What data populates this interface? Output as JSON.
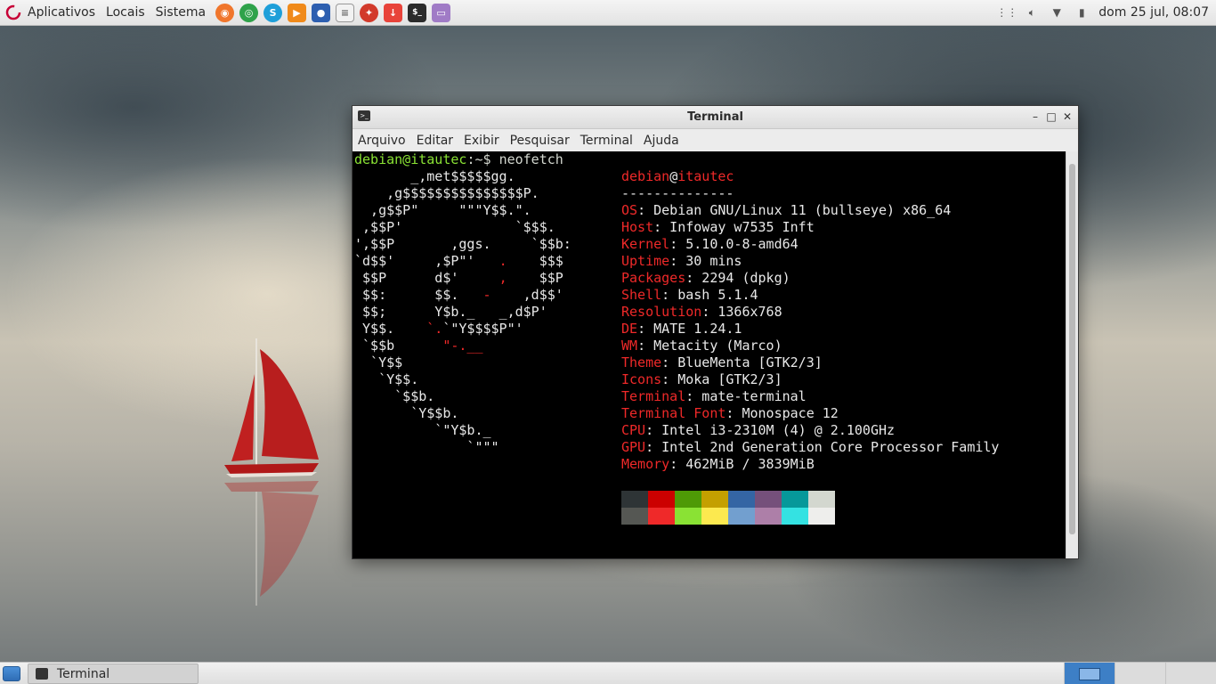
{
  "top_panel": {
    "menus": [
      "Aplicativos",
      "Locais",
      "Sistema"
    ],
    "launchers": [
      {
        "icon": "firefox-icon",
        "color": "#f0762c"
      },
      {
        "icon": "chrome-icon",
        "color": "#2fa24a"
      },
      {
        "icon": "skype-icon",
        "color": "#1e9fd9"
      },
      {
        "icon": "vlc-icon",
        "color": "#f08a1a"
      },
      {
        "icon": "obs-icon",
        "color": "#2d5fb0"
      },
      {
        "icon": "text-editor-icon",
        "color": "#f2f2f2"
      },
      {
        "icon": "transmission-icon",
        "color": "#d23a2b"
      },
      {
        "icon": "downloader-icon",
        "color": "#e8433a"
      },
      {
        "icon": "terminal-icon",
        "color": "#2b2b2b"
      },
      {
        "icon": "file-manager-icon",
        "color": "#a07bc6"
      }
    ],
    "clock": "dom 25 jul, 08:07"
  },
  "window": {
    "title": "Terminal",
    "menu": [
      "Arquivo",
      "Editar",
      "Exibir",
      "Pesquisar",
      "Terminal",
      "Ajuda"
    ]
  },
  "terminal": {
    "prompt_user": "debian@itautec",
    "prompt_path": ":~$ ",
    "command": "neofetch",
    "header": "debian@itautec",
    "separator": "--------------",
    "info": [
      {
        "label": "OS",
        "value": ": Debian GNU/Linux 11 (bullseye) x86_64"
      },
      {
        "label": "Host",
        "value": ": Infoway w7535 Inft"
      },
      {
        "label": "Kernel",
        "value": ": 5.10.0-8-amd64"
      },
      {
        "label": "Uptime",
        "value": ": 30 mins"
      },
      {
        "label": "Packages",
        "value": ": 2294 (dpkg)"
      },
      {
        "label": "Shell",
        "value": ": bash 5.1.4"
      },
      {
        "label": "Resolution",
        "value": ": 1366x768"
      },
      {
        "label": "DE",
        "value": ": MATE 1.24.1"
      },
      {
        "label": "WM",
        "value": ": Metacity (Marco)"
      },
      {
        "label": "Theme",
        "value": ": BlueMenta [GTK2/3]"
      },
      {
        "label": "Icons",
        "value": ": Moka [GTK2/3]"
      },
      {
        "label": "Terminal",
        "value": ": mate-terminal"
      },
      {
        "label": "Terminal Font",
        "value": ": Monospace 12"
      },
      {
        "label": "CPU",
        "value": ": Intel i3-2310M (4) @ 2.100GHz"
      },
      {
        "label": "GPU",
        "value": ": Intel 2nd Generation Core Processor Family"
      },
      {
        "label": "Memory",
        "value": ": 462MiB / 3839MiB"
      }
    ],
    "palette_top": [
      "#2e3436",
      "#cc0000",
      "#4e9a06",
      "#c4a000",
      "#3465a4",
      "#75507b",
      "#06989a",
      "#d3d7cf"
    ],
    "palette_bottom": [
      "#555753",
      "#ef2929",
      "#8ae234",
      "#fce94f",
      "#729fcf",
      "#ad7fa8",
      "#34e2e2",
      "#eeeeec"
    ]
  },
  "bottom_panel": {
    "task_label": "Terminal"
  }
}
